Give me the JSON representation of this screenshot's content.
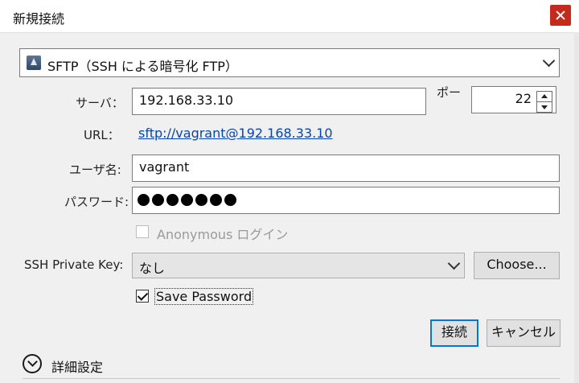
{
  "window": {
    "title": "新規接続",
    "close_icon": "close-icon"
  },
  "protocol": {
    "icon": "sftp-protocol-icon",
    "selected": "SFTP（SSH による暗号化 FTP）"
  },
  "server": {
    "label": "サーバ：",
    "value": "192.168.33.10"
  },
  "port": {
    "label": "ポー",
    "value": "22"
  },
  "url": {
    "label": "URL：",
    "value": "sftp://vagrant@192.168.33.10"
  },
  "username": {
    "label": "ユーザ名:",
    "value": "vagrant"
  },
  "password": {
    "label": "パスワード:",
    "masked_length": 7
  },
  "anonymous": {
    "label": "Anonymous ログイン",
    "checked": false,
    "enabled": false
  },
  "private_key": {
    "label": "SSH Private Key:",
    "selected": "なし",
    "choose_label": "Choose..."
  },
  "save_password": {
    "label": "Save Password",
    "checked": true
  },
  "buttons": {
    "connect": "接続",
    "cancel": "キャンセル"
  },
  "advanced": {
    "label": "詳細設定",
    "icon": "chevron-down-circle-icon"
  },
  "colors": {
    "close": "#c42b1c",
    "link": "#0645ad",
    "primary_border": "#0078d7"
  }
}
